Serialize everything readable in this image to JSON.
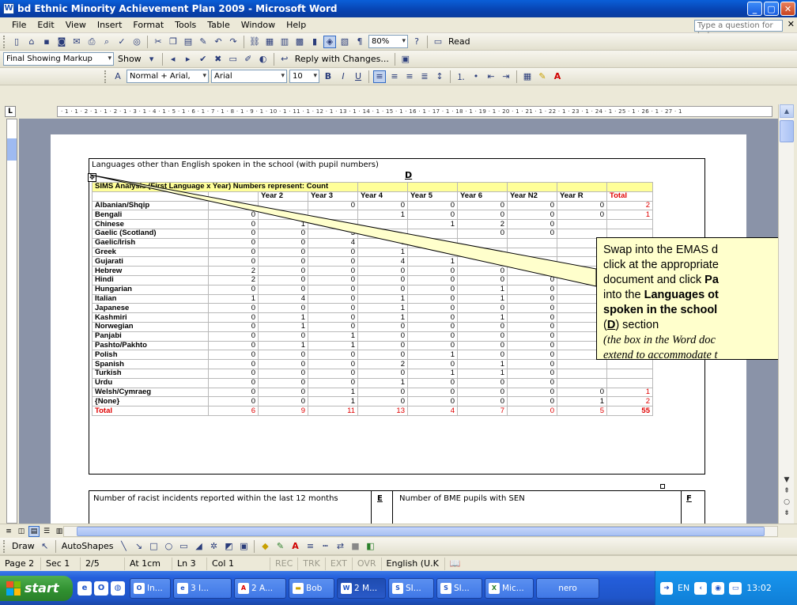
{
  "window": {
    "title": "bd Ethnic Minority Achievement Plan  2009 - Microsoft Word",
    "app_icon": "W",
    "buttons": [
      "_",
      "▢",
      "✕"
    ]
  },
  "menubar": {
    "items": [
      "File",
      "Edit",
      "View",
      "Insert",
      "Format",
      "Tools",
      "Table",
      "Window",
      "Help"
    ],
    "help_placeholder": "Type a question for help",
    "close": "✕"
  },
  "standard_toolbar": {
    "zoom": "80%",
    "read_label": "Read"
  },
  "reviewing_toolbar": {
    "markup_mode": "Final Showing Markup",
    "show_label": "Show",
    "reply_label": "Reply with Changes..."
  },
  "formatting_toolbar": {
    "style": "Normal + Arial,",
    "font": "Arial",
    "size": "10",
    "bold": "B",
    "italic": "I",
    "underline": "U"
  },
  "ruler": {
    "corner": "L",
    "marks": "· 1 · 1 · 2 · 1 · 1 · 2 · 1 · 3 · 1 · 4 · 1 · 5 · 1 · 6 · 1 · 7 · 1 · 8 · 1 · 9 · 1 · 10 · 1 · 11 · 1 · 12 · 1 · 13 · 1 · 14 · 1 · 15 · 1 · 16 · 1 · 17 · 1 · 18 · 1 · 19 · 1 · 20 · 1 · 21 · 1 · 22 · 1 · 23 · 1 · 24 · 1 · 25 · 1 · 26 · 1 · 27 · 1"
  },
  "document": {
    "section_title": "Languages other than English spoken in the school (with pupil numbers)",
    "section_letter": "D",
    "move_handle": "✥",
    "table": {
      "header": "SIMS Analysis (First Language x Year)  Numbers represent: Count",
      "columns": [
        "",
        "",
        "Year 2",
        "Year 3",
        "Year 4",
        "Year 5",
        "Year 6",
        "Year N2",
        "Year R",
        "Total"
      ],
      "rows": [
        {
          "lang": "Albanian/Shqip",
          "v": [
            "",
            "",
            "0",
            "0",
            "0",
            "0",
            "0",
            "0",
            "2"
          ]
        },
        {
          "lang": "Bengali",
          "v": [
            "0",
            "",
            "",
            "1",
            "0",
            "0",
            "0",
            "0",
            "1"
          ]
        },
        {
          "lang": "Chinese",
          "v": [
            "0",
            "1",
            "",
            "",
            "1",
            "2",
            "0",
            "",
            ""
          ]
        },
        {
          "lang": "Gaelic (Scotland)",
          "v": [
            "0",
            "0",
            "3",
            "",
            "",
            "0",
            "0",
            "",
            ""
          ]
        },
        {
          "lang": "Gaelic/Irish",
          "v": [
            "0",
            "0",
            "4",
            "0",
            "",
            "",
            "",
            "",
            ""
          ]
        },
        {
          "lang": "Greek",
          "v": [
            "0",
            "0",
            "0",
            "1",
            "",
            "",
            "",
            "",
            ""
          ]
        },
        {
          "lang": "Gujarati",
          "v": [
            "0",
            "0",
            "0",
            "4",
            "1",
            "",
            "",
            "",
            ""
          ]
        },
        {
          "lang": "Hebrew",
          "v": [
            "2",
            "0",
            "0",
            "0",
            "0",
            "0",
            "",
            "",
            ""
          ]
        },
        {
          "lang": "Hindi",
          "v": [
            "2",
            "0",
            "0",
            "0",
            "0",
            "0",
            "0",
            "",
            ""
          ]
        },
        {
          "lang": "Hungarian",
          "v": [
            "0",
            "0",
            "0",
            "0",
            "0",
            "1",
            "0",
            "",
            ""
          ]
        },
        {
          "lang": "Italian",
          "v": [
            "1",
            "4",
            "0",
            "1",
            "0",
            "1",
            "0",
            "",
            ""
          ]
        },
        {
          "lang": "Japanese",
          "v": [
            "0",
            "0",
            "0",
            "1",
            "0",
            "0",
            "0",
            "",
            ""
          ]
        },
        {
          "lang": "Kashmiri",
          "v": [
            "0",
            "1",
            "0",
            "1",
            "0",
            "1",
            "0",
            "",
            ""
          ]
        },
        {
          "lang": "Norwegian",
          "v": [
            "0",
            "1",
            "0",
            "0",
            "0",
            "0",
            "0",
            "",
            ""
          ]
        },
        {
          "lang": "Panjabi",
          "v": [
            "0",
            "0",
            "1",
            "0",
            "0",
            "0",
            "0",
            "",
            ""
          ]
        },
        {
          "lang": "Pashto/Pakhto",
          "v": [
            "0",
            "1",
            "1",
            "0",
            "0",
            "0",
            "0",
            "",
            ""
          ]
        },
        {
          "lang": "Polish",
          "v": [
            "0",
            "0",
            "0",
            "0",
            "1",
            "0",
            "0",
            "",
            ""
          ]
        },
        {
          "lang": "Spanish",
          "v": [
            "0",
            "0",
            "0",
            "2",
            "0",
            "1",
            "0",
            "",
            ""
          ]
        },
        {
          "lang": "Turkish",
          "v": [
            "0",
            "0",
            "0",
            "0",
            "1",
            "1",
            "0",
            "",
            ""
          ]
        },
        {
          "lang": "Urdu",
          "v": [
            "0",
            "0",
            "0",
            "1",
            "0",
            "0",
            "0",
            "",
            ""
          ]
        },
        {
          "lang": "Welsh/Cymraeg",
          "v": [
            "0",
            "0",
            "1",
            "0",
            "0",
            "0",
            "0",
            "0",
            "1"
          ]
        },
        {
          "lang": "{None}",
          "v": [
            "0",
            "0",
            "1",
            "0",
            "0",
            "0",
            "0",
            "1",
            "2"
          ]
        }
      ],
      "total_row": {
        "lang": "Total",
        "v": [
          "6",
          "9",
          "11",
          "13",
          "4",
          "7",
          "0",
          "5",
          "55"
        ]
      }
    },
    "bottom_left_text": "Number of racist incidents reported  within the last 12 months",
    "bottom_left_letter": "E",
    "bottom_right_text": "Number of BME pupils with SEN",
    "bottom_right_letter": "F"
  },
  "callout": {
    "line1": "Swap into the EMAS d",
    "line2": "click at the appropriate",
    "line3a": "document and click ",
    "line3b": "Pa",
    "line4a": "into the ",
    "line4b": "Languages ot",
    "line5": "spoken in the school",
    "line6a": "(",
    "line6b": "D",
    "line6c": ") section",
    "line7": "(the box in the Word doc",
    "line8": "extend to accommodate t"
  },
  "drawing_toolbar": {
    "draw_label": "Draw",
    "autoshapes_label": "AutoShapes"
  },
  "statusbar": {
    "page": "Page 2",
    "sec": "Sec 1",
    "pos": "2/5",
    "at": "At 1cm",
    "ln": "Ln 3",
    "col": "Col 1",
    "rec": "REC",
    "trk": "TRK",
    "ext": "EXT",
    "ovr": "OVR",
    "lang": "English (U.K"
  },
  "taskbar": {
    "start": "start",
    "tasks": [
      "In...",
      "3 I...",
      "2 A...",
      "Bob",
      "2 M...",
      "SI...",
      "SI...",
      "Mic..."
    ],
    "tray_lang": "EN",
    "tray_nero": "nero",
    "clock": "13:02"
  }
}
